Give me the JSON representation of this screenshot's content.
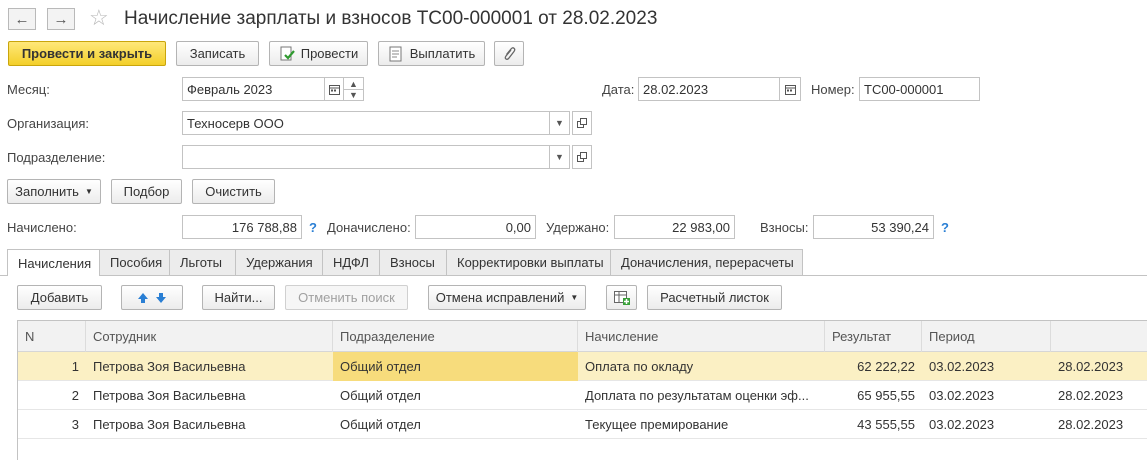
{
  "nav": {
    "back": "←",
    "forward": "→",
    "star": "☆"
  },
  "title": "Начисление зарплаты и взносов ТС00-000001 от 28.02.2023",
  "toolbar": {
    "post_close": "Провести и закрыть",
    "save": "Записать",
    "post": "Провести",
    "pay": "Выплатить",
    "attach": "📎"
  },
  "form": {
    "month_label": "Месяц:",
    "month_value": "Февраль 2023",
    "date_label": "Дата:",
    "date_value": "28.02.2023",
    "number_label": "Номер:",
    "number_value": "ТС00-000001",
    "org_label": "Организация:",
    "org_value": "Техносерв ООО",
    "dept_label": "Подразделение:",
    "dept_value": ""
  },
  "actions": {
    "fill": "Заполнить",
    "select": "Подбор",
    "clear": "Очистить"
  },
  "totals": {
    "accrued_label": "Начислено:",
    "accrued": "176 788,88",
    "extra_label": "Доначислено:",
    "extra": "0,00",
    "withheld_label": "Удержано:",
    "withheld": "22 983,00",
    "contrib_label": "Взносы:",
    "contrib": "53 390,24",
    "help": "?"
  },
  "tabs": [
    {
      "label": "Начисления"
    },
    {
      "label": "Пособия"
    },
    {
      "label": "Льготы"
    },
    {
      "label": "Удержания"
    },
    {
      "label": "НДФЛ"
    },
    {
      "label": "Взносы"
    },
    {
      "label": "Корректировки выплаты"
    },
    {
      "label": "Доначисления, перерасчеты"
    }
  ],
  "table_toolbar": {
    "add": "Добавить",
    "find": "Найти...",
    "cancel_search": "Отменить поиск",
    "cancel_corrections": "Отмена исправлений",
    "payslip": "Расчетный листок"
  },
  "table": {
    "columns": [
      "N",
      "Сотрудник",
      "Подразделение",
      "Начисление",
      "Результат",
      "Период",
      ""
    ],
    "rows": [
      [
        "1",
        "Петрова Зоя Васильевна",
        "Общий отдел",
        "Оплата по окладу",
        "62 222,22",
        "03.02.2023",
        "28.02.2023"
      ],
      [
        "2",
        "Петрова Зоя Васильевна",
        "Общий отдел",
        "Доплата по результатам оценки эф...",
        "65 955,55",
        "03.02.2023",
        "28.02.2023"
      ],
      [
        "3",
        "Петрова Зоя Васильевна",
        "Общий отдел",
        "Текущее премирование",
        "43 555,55",
        "03.02.2023",
        "28.02.2023"
      ]
    ]
  },
  "colors": {
    "primary": "#f3cf2a",
    "selected_row": "#fbf0c4",
    "active_cell": "#f7dc7c",
    "help": "#2a7fd4",
    "arrow": "#2a7fd4"
  }
}
